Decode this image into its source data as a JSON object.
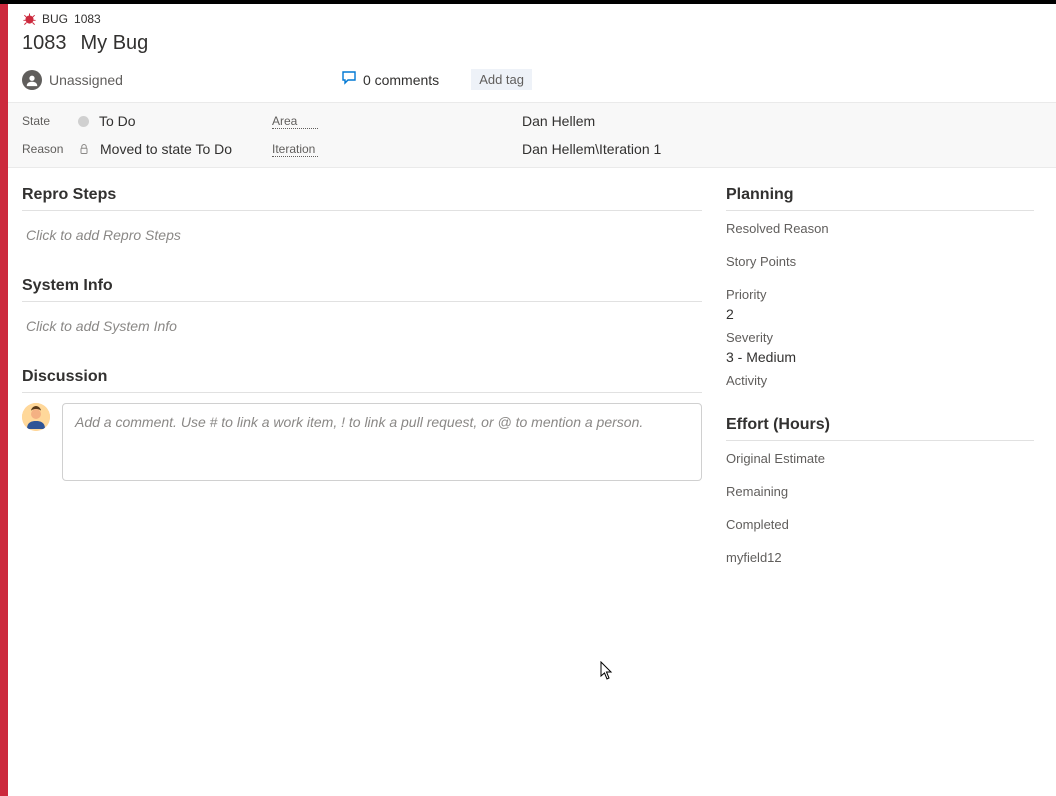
{
  "breadcrumb": {
    "type_label": "BUG",
    "id": "1083"
  },
  "title": {
    "number": "1083",
    "text": "My Bug"
  },
  "assignee": {
    "label": "Unassigned"
  },
  "comments": {
    "label": "0 comments"
  },
  "tags": {
    "add_label": "Add tag"
  },
  "fields": {
    "state": {
      "label": "State",
      "value": "To Do"
    },
    "area": {
      "label": "Area",
      "value": "Dan Hellem"
    },
    "reason": {
      "label": "Reason",
      "value": "Moved to state To Do"
    },
    "iteration": {
      "label": "Iteration",
      "value": "Dan Hellem\\Iteration 1"
    }
  },
  "sections": {
    "repro": {
      "title": "Repro Steps",
      "placeholder": "Click to add Repro Steps"
    },
    "sysinfo": {
      "title": "System Info",
      "placeholder": "Click to add System Info"
    },
    "discussion": {
      "title": "Discussion",
      "placeholder": "Add a comment. Use # to link a work item, ! to link a pull request, or @ to mention a person."
    }
  },
  "planning": {
    "title": "Planning",
    "resolved_reason": {
      "label": "Resolved Reason",
      "value": ""
    },
    "story_points": {
      "label": "Story Points",
      "value": ""
    },
    "priority": {
      "label": "Priority",
      "value": "2"
    },
    "severity": {
      "label": "Severity",
      "value": "3 - Medium"
    },
    "activity": {
      "label": "Activity",
      "value": ""
    }
  },
  "effort": {
    "title": "Effort (Hours)",
    "original": {
      "label": "Original Estimate",
      "value": ""
    },
    "remaining": {
      "label": "Remaining",
      "value": ""
    },
    "completed": {
      "label": "Completed",
      "value": ""
    },
    "custom": {
      "label": "myfield12",
      "value": ""
    }
  }
}
